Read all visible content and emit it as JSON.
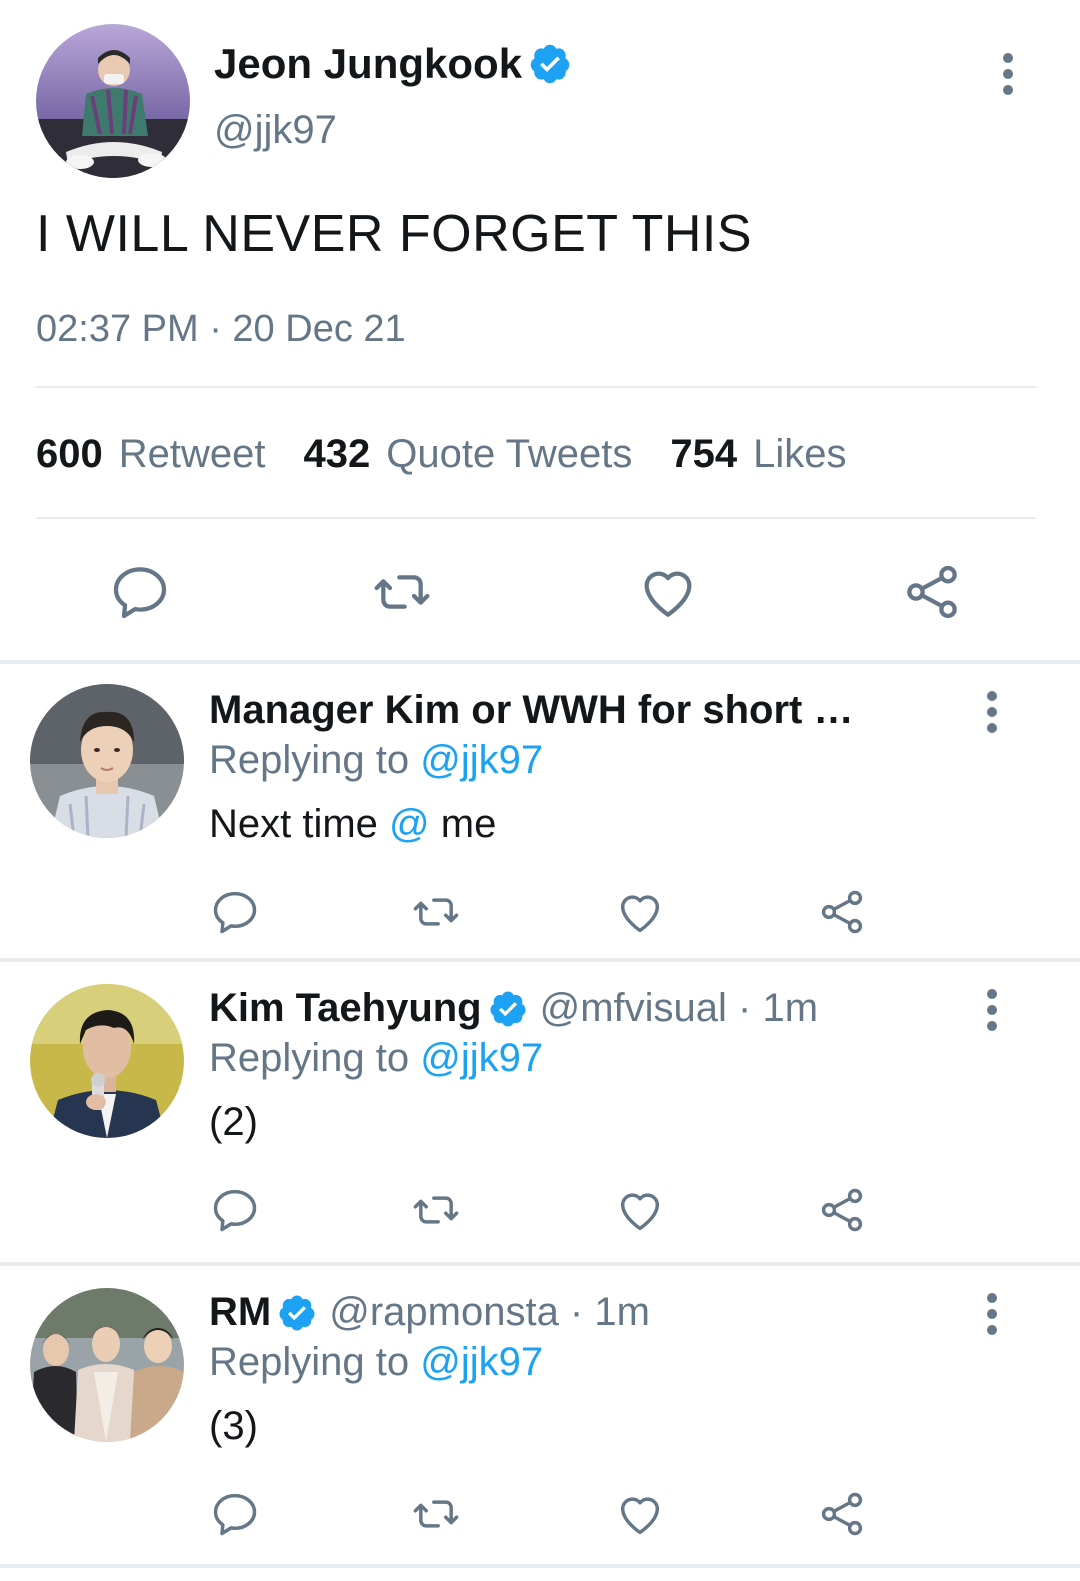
{
  "main_tweet": {
    "author_name": "Jeon Jungkook",
    "handle": "@jjk97",
    "text": "I WILL NEVER FORGET THIS",
    "timestamp": "02:37 PM · 20 Dec 21",
    "stats": [
      {
        "count": "600",
        "label": "Retweet"
      },
      {
        "count": "432",
        "label": "Quote Tweets"
      },
      {
        "count": "754",
        "label": "Likes"
      }
    ]
  },
  "replies": [
    {
      "author_name": "Manager Kim or WWH for short …",
      "handle_meta": "",
      "replying_prefix": "Replying to ",
      "replying_handle": "@jjk97",
      "text_before": "Next time ",
      "text_mention": "@",
      "text_after": " me",
      "verified": false
    },
    {
      "author_name": "Kim Taehyung",
      "handle_meta": "@mfvisual · 1m",
      "replying_prefix": "Replying to ",
      "replying_handle": "@jjk97",
      "text_before": "(2)",
      "text_mention": "",
      "text_after": "",
      "verified": true
    },
    {
      "author_name": "RM",
      "handle_meta": "@rapmonsta · 1m",
      "replying_prefix": "Replying to ",
      "replying_handle": "@jjk97",
      "text_before": "(3)",
      "text_mention": "",
      "text_after": "",
      "verified": true
    }
  ],
  "colors": {
    "accent": "#1da1f2",
    "muted": "#657786",
    "text": "#14171a",
    "divider": "#e6ecf0"
  },
  "icons": [
    "verified-badge-icon",
    "more-vertical-icon",
    "reply-icon",
    "retweet-icon",
    "like-icon",
    "share-icon"
  ]
}
